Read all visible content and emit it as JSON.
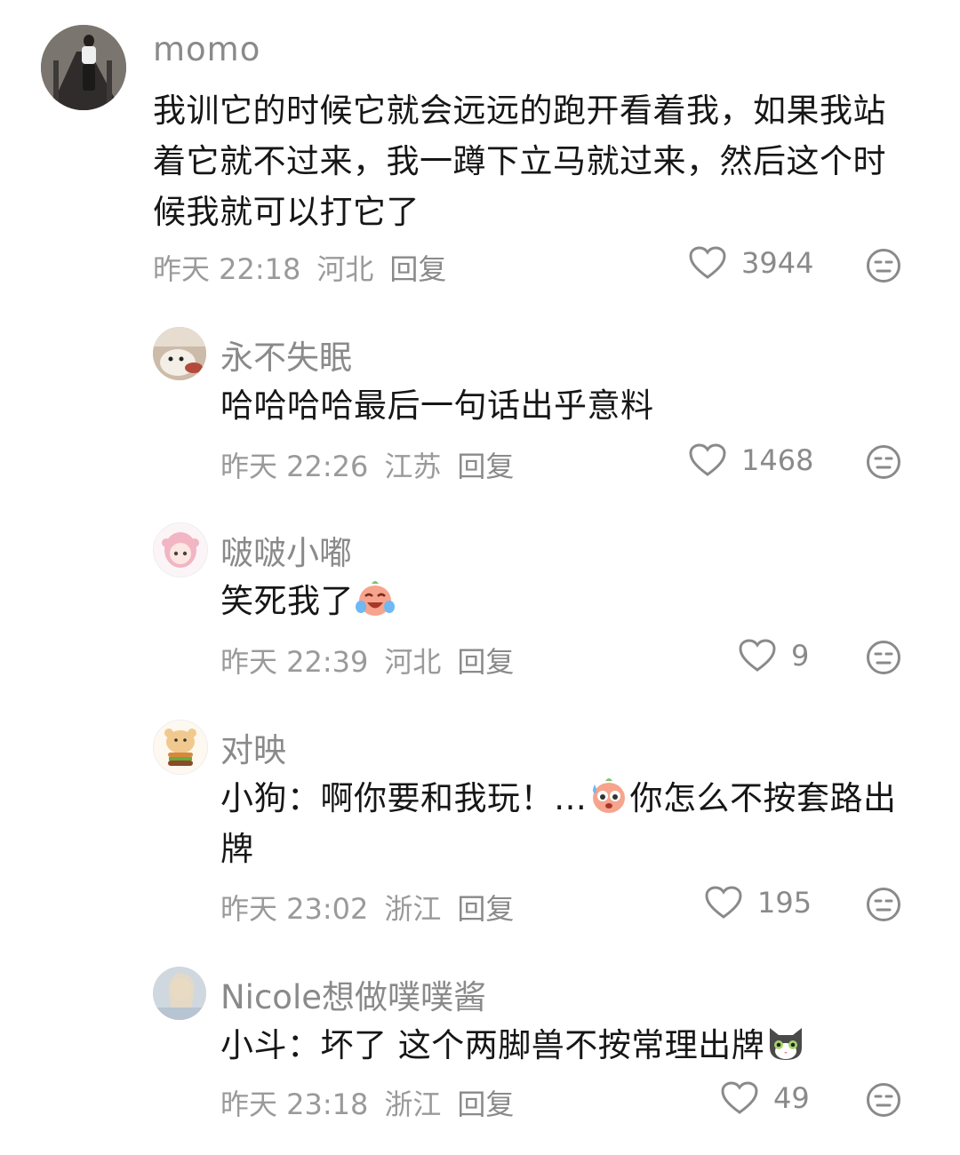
{
  "comments": [
    {
      "username": "momo",
      "text": "我训它的时候它就会远远的跑开看着我，如果我站着它就不过来，我一蹲下立马就过来，然后这个时候我就可以打它了",
      "date": "昨天 22:18",
      "location": "河北",
      "reply_label": "回复",
      "likes": "3944"
    },
    {
      "username": "永不失眠",
      "text": "哈哈哈哈最后一句话出乎意料",
      "date": "昨天 22:26",
      "location": "江苏",
      "reply_label": "回复",
      "likes": "1468"
    },
    {
      "username": "啵啵小嘟",
      "text": "笑死我了",
      "date": "昨天 22:39",
      "location": "河北",
      "reply_label": "回复",
      "likes": "9",
      "trailing_emoji": "laugh-cry-emoji"
    },
    {
      "username": "对映",
      "text_before_emoji": "小狗：啊你要和我玩！…",
      "text_after_emoji": "你怎么不按套路出牌",
      "date": "昨天 23:02",
      "location": "浙江",
      "reply_label": "回复",
      "likes": "195",
      "inline_emoji": "sweat-emoji"
    },
    {
      "username": "Nicole想做噗噗酱",
      "text": "小斗：坏了 这个两脚兽不按常理出牌",
      "date": "昨天 23:18",
      "location": "浙江",
      "reply_label": "回复",
      "likes": "49",
      "trailing_emoji": "cat-emoji"
    }
  ],
  "colors": {
    "meta_gray": "#9a9a9a",
    "username_gray": "#8a8a8a",
    "text_dark": "#161616"
  },
  "icons": {
    "like": "heart-outline-icon",
    "dislike": "meh-face-icon"
  }
}
